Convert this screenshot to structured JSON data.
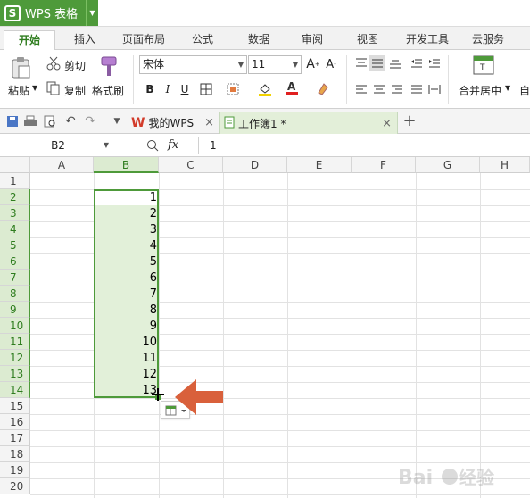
{
  "app": {
    "name": "WPS 表格",
    "logo_letter": "S"
  },
  "ribbon_tabs": [
    "开始",
    "插入",
    "页面布局",
    "公式",
    "数据",
    "审阅",
    "视图",
    "开发工具",
    "云服务"
  ],
  "ribbon": {
    "paste_label": "粘贴",
    "cut_label": "剪切",
    "copy_label": "复制",
    "format_painter_label": "格式刷",
    "font_name": "宋体",
    "font_size": "11",
    "merge_center_label": "合并居中",
    "auto_wrap_label": "自"
  },
  "doc_tabs": {
    "wps_label": "我的WPS",
    "workbook_label": "工作簿1 *",
    "add_label": "+"
  },
  "formula_bar": {
    "cell_ref": "B2",
    "fx_label": "fx",
    "value": "1"
  },
  "grid": {
    "columns": [
      "A",
      "B",
      "C",
      "D",
      "E",
      "F",
      "G",
      "H"
    ],
    "rows": [
      "1",
      "2",
      "3",
      "4",
      "5",
      "6",
      "7",
      "8",
      "9",
      "10",
      "11",
      "12",
      "13",
      "14",
      "15",
      "16",
      "17",
      "18",
      "19",
      "20"
    ],
    "b_values": [
      "1",
      "2",
      "3",
      "4",
      "5",
      "6",
      "7",
      "8",
      "9",
      "10",
      "11",
      "12",
      "13"
    ]
  },
  "colors": {
    "accent_green": "#4e9a3a",
    "selection_fill": "#e2f0d9",
    "arrow": "#d9603b"
  }
}
